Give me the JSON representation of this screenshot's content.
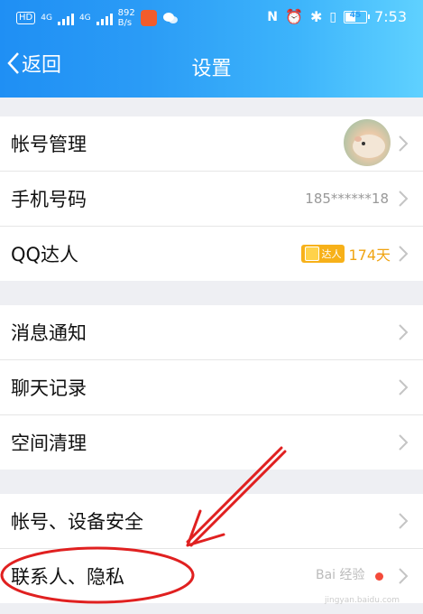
{
  "status_bar": {
    "hd": "HD",
    "net1": "4G",
    "net2": "4G",
    "speed_value": "892",
    "speed_unit": "B/s",
    "battery_level": "45",
    "time": "7:53",
    "icons": [
      "signal-icon",
      "video-app-icon",
      "wechat-icon",
      "nfc-icon",
      "alarm-icon",
      "bluetooth-icon",
      "vibrate-icon",
      "battery-icon"
    ]
  },
  "nav": {
    "back_label": "返回",
    "title": "设置"
  },
  "groups": [
    {
      "rows": [
        {
          "label": "帐号管理"
        },
        {
          "label": "手机号码",
          "value": "185******18"
        },
        {
          "label": "QQ达人",
          "badge": "达人",
          "value": "174天"
        }
      ]
    },
    {
      "rows": [
        {
          "label": "消息通知"
        },
        {
          "label": "聊天记录"
        },
        {
          "label": "空间清理"
        }
      ]
    },
    {
      "rows": [
        {
          "label": "帐号、设备安全"
        },
        {
          "label": "联系人、隐私"
        }
      ]
    }
  ],
  "watermark": {
    "text": "Bai 经验",
    "sub": "jingyan.baidu.com"
  },
  "colors": {
    "header_start": "#1f8ff4",
    "header_end": "#5fd1ff",
    "annotation_red": "#e02020",
    "vip_gold": "#f0a412",
    "dot_red": "#f44a3a"
  }
}
